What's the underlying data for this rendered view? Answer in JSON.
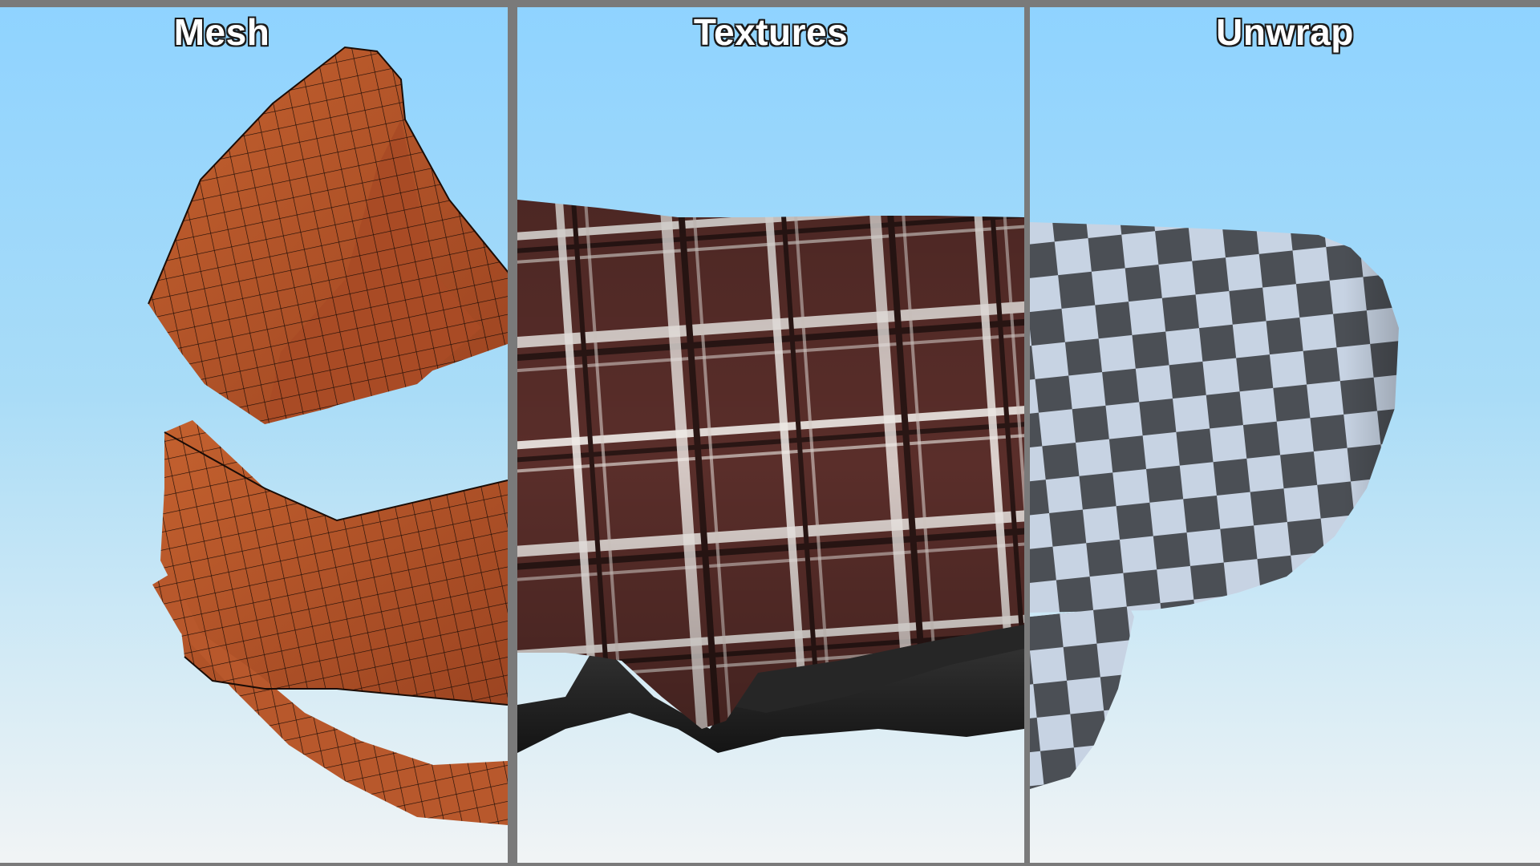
{
  "panels": [
    {
      "title": "Mesh",
      "render": "wireframe-mesh"
    },
    {
      "title": "Textures",
      "render": "plaid-texture"
    },
    {
      "title": "Unwrap",
      "render": "checker-uv"
    }
  ],
  "colors": {
    "frame": "#7a7a7a",
    "sky_top": "#8fd3ff",
    "sky_bottom": "#f1f4f5",
    "mesh_fill": "#b5552c",
    "mesh_wire": "#1a0c06",
    "plaid_base": "#5a2e2a",
    "plaid_stripe_white": "#f2eeea",
    "plaid_stripe_dark": "#2a1614",
    "lining": "#1f1f1f",
    "checker_light": "#c7d3e3",
    "checker_dark": "#4b4f55"
  }
}
